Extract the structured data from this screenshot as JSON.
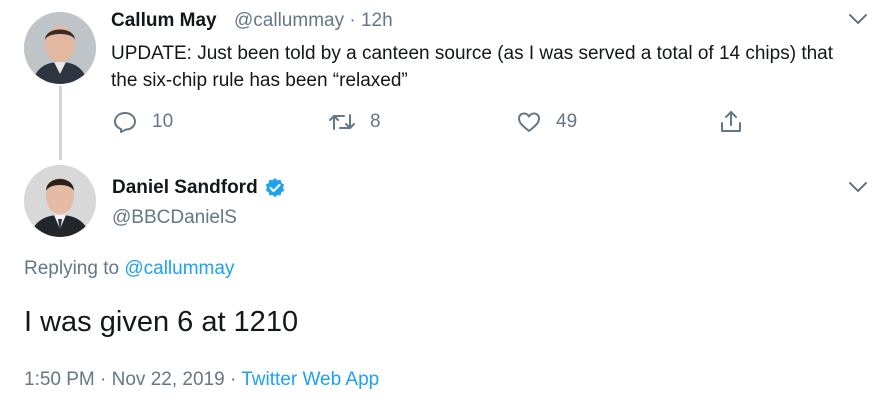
{
  "tweet1": {
    "name": "Callum May",
    "handle": "@callummay",
    "separator": "·",
    "time": "12h",
    "text": "UPDATE: Just been told by a canteen source (as I was served a total of 14 chips) that the six-chip rule has been “relaxed”",
    "replies": "10",
    "retweets": "8",
    "likes": "49"
  },
  "tweet2": {
    "name": "Daniel Sandford",
    "handle": "@BBCDanielS",
    "verified_color": "#1da1f2",
    "replying_prefix": "Replying to",
    "replying_to": "@callummay",
    "text": "I was given 6 at 1210",
    "timestamp": "1:50 PM · Nov 22, 2019 ·",
    "source": "Twitter Web App"
  },
  "colors": {
    "accent": "#1da1f2",
    "muted": "#657786",
    "text": "#14171a"
  }
}
